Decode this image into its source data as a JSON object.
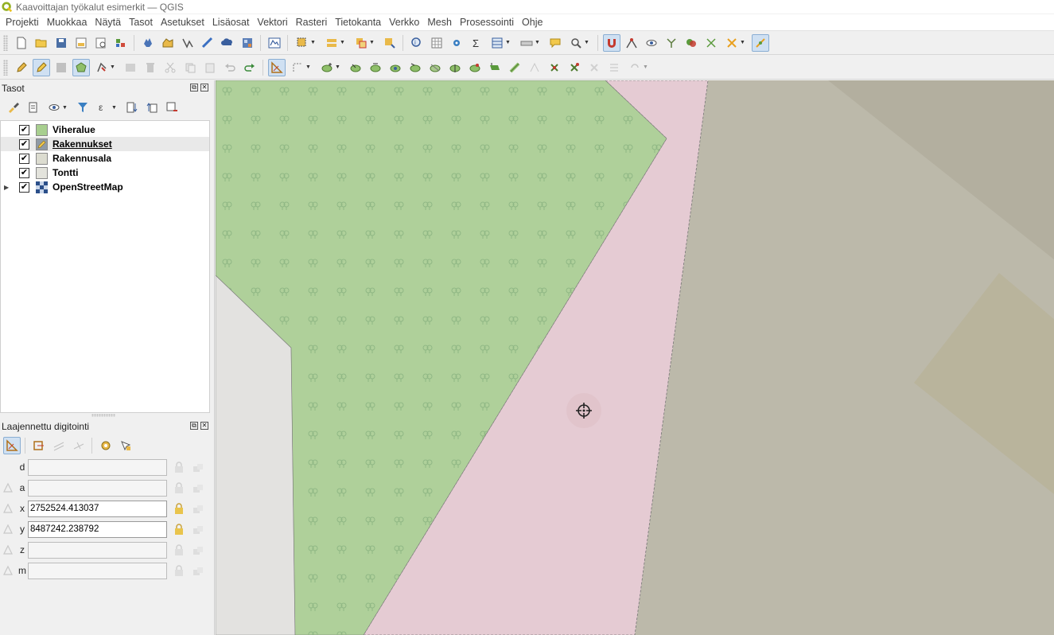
{
  "window": {
    "title": "Kaavoittajan työkalut esimerkit — QGIS"
  },
  "menu": [
    "Projekti",
    "Muokkaa",
    "Näytä",
    "Tasot",
    "Asetukset",
    "Lisäosat",
    "Vektori",
    "Rasteri",
    "Tietokanta",
    "Verkko",
    "Mesh",
    "Prosessointi",
    "Ohje"
  ],
  "layers_panel": {
    "title": "Tasot",
    "layers": [
      {
        "name": "Viheralue",
        "checked": true,
        "swatch": "#a8cf8f",
        "selected": false,
        "underline": false,
        "expandable": false
      },
      {
        "name": "Rakennukset",
        "checked": true,
        "swatch": "#8f9aa6",
        "selected": true,
        "underline": true,
        "expandable": false
      },
      {
        "name": "Rakennusala",
        "checked": true,
        "swatch": "#dcdcd0",
        "selected": false,
        "underline": false,
        "expandable": false
      },
      {
        "name": "Tontti",
        "checked": true,
        "swatch": "#e3e3dc",
        "selected": false,
        "underline": false,
        "expandable": false
      },
      {
        "name": "OpenStreetMap",
        "checked": true,
        "swatch": "osm-icon",
        "selected": false,
        "underline": false,
        "expandable": true
      }
    ]
  },
  "adv_digitizing": {
    "title": "Laajennettu digitointi",
    "fields": [
      {
        "label": "d",
        "value": "",
        "enabled": false
      },
      {
        "label": "a",
        "value": "",
        "enabled": false
      },
      {
        "label": "x",
        "value": "2752524.413037",
        "enabled": true
      },
      {
        "label": "y",
        "value": "8487242.238792",
        "enabled": true
      },
      {
        "label": "z",
        "value": "",
        "enabled": false
      },
      {
        "label": "m",
        "value": "",
        "enabled": false
      }
    ]
  },
  "colors": {
    "green_area": "#afd09a",
    "pink_border": "#e5cbd3",
    "osm_bg": "#bcb9aa",
    "osm_dark": "#b3af9f",
    "white_area": "#e3e2e0"
  }
}
